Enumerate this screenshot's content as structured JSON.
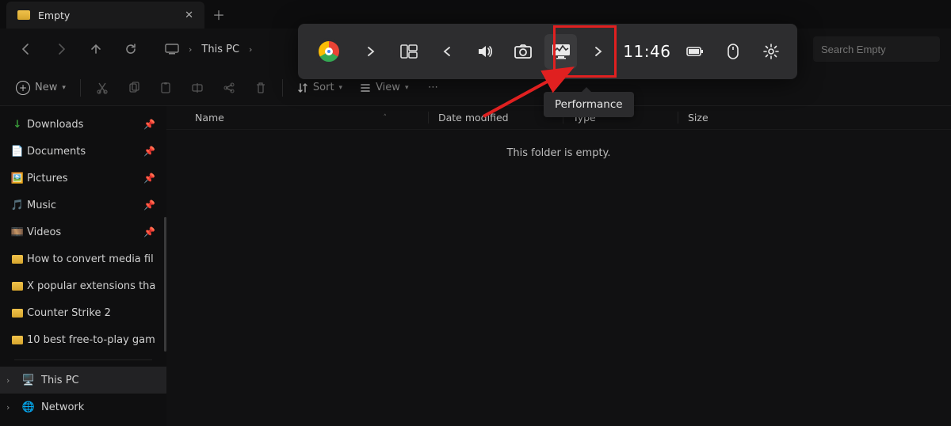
{
  "tab": {
    "title": "Empty"
  },
  "address": {
    "root": "This PC",
    "current": ""
  },
  "search_placeholder": "Search Empty",
  "toolbar": {
    "new": "New",
    "sort": "Sort",
    "view": "View"
  },
  "sidebar": {
    "items": [
      {
        "label": "Downloads",
        "icon": "download",
        "pinned": true
      },
      {
        "label": "Documents",
        "icon": "doc",
        "pinned": true
      },
      {
        "label": "Pictures",
        "icon": "pic",
        "pinned": true
      },
      {
        "label": "Music",
        "icon": "music",
        "pinned": true
      },
      {
        "label": "Videos",
        "icon": "video",
        "pinned": true
      },
      {
        "label": "How to convert media fil",
        "icon": "folder"
      },
      {
        "label": "X popular extensions tha",
        "icon": "folder"
      },
      {
        "label": "Counter Strike 2",
        "icon": "folder"
      },
      {
        "label": "10 best free-to-play gam",
        "icon": "folder"
      }
    ],
    "roots": [
      {
        "label": "This PC",
        "icon": "pc",
        "selected": true
      },
      {
        "label": "Network",
        "icon": "net"
      }
    ]
  },
  "columns": {
    "name": "Name",
    "date": "Date modified",
    "type": "Type",
    "size": "Size"
  },
  "empty_message": "This folder is empty.",
  "overlay": {
    "time": "11:46",
    "tooltip": "Performance"
  }
}
